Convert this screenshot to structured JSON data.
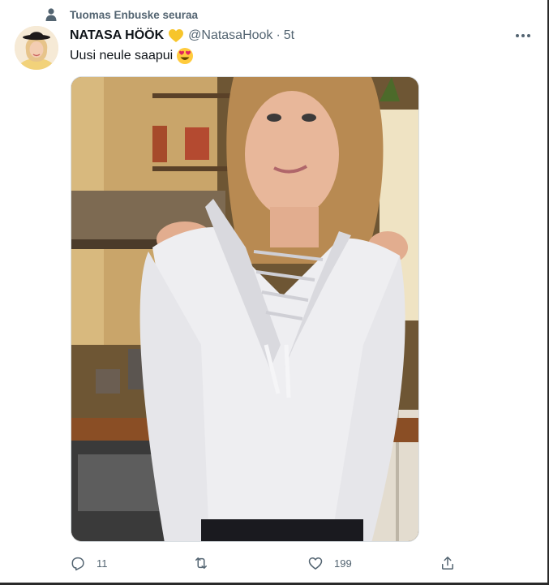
{
  "social_context": {
    "text": "Tuomas Enbuske seuraa",
    "icon": "person-icon"
  },
  "tweet": {
    "display_name": "NATASA HÖÖK",
    "name_emoji": "yellow-heart-icon",
    "handle": "@NatasaHook",
    "separator": "·",
    "time": "5t",
    "text": "Uusi neule saapui",
    "text_emoji": "heart-eyes-emoji-icon",
    "media_alt": "Photo of a woman in a white off-shoulder lace-up sweater in a kitchen"
  },
  "actions": {
    "reply_count": "11",
    "retweet_count": "",
    "like_count": "199"
  },
  "colors": {
    "text_primary": "#0f1419",
    "text_secondary": "#536471",
    "heart_yellow": "#f7c52b"
  }
}
